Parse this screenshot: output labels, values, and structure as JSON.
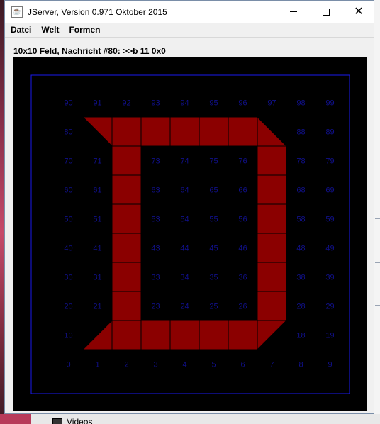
{
  "window": {
    "title": "JServer, Version 0.971 Oktober 2015",
    "icon": "java-icon",
    "controls": [
      "minimize",
      "maximize",
      "close"
    ],
    "close_glyph": "✕"
  },
  "menu": {
    "items": [
      "Datei",
      "Welt",
      "Formen"
    ]
  },
  "status": {
    "text": "10x10 Feld, Nachricht #80: >>b 11 0x0"
  },
  "board": {
    "rows": 10,
    "cols": 10,
    "background_color": "#000000",
    "border_color": "#1a1aee",
    "label_color": "#10108a",
    "piece_color": "#8b0000",
    "labels": [
      [
        "90",
        "91",
        "92",
        "93",
        "94",
        "95",
        "96",
        "97",
        "98",
        "99"
      ],
      [
        "80",
        "",
        "",
        "",
        "",
        "",
        "",
        "",
        "88",
        "89"
      ],
      [
        "70",
        "71",
        "",
        "73",
        "74",
        "75",
        "76",
        "",
        "78",
        "79"
      ],
      [
        "60",
        "61",
        "",
        "63",
        "64",
        "65",
        "66",
        "",
        "68",
        "69"
      ],
      [
        "50",
        "51",
        "",
        "53",
        "54",
        "55",
        "56",
        "",
        "58",
        "59"
      ],
      [
        "40",
        "41",
        "",
        "43",
        "44",
        "45",
        "46",
        "",
        "48",
        "49"
      ],
      [
        "30",
        "31",
        "",
        "33",
        "34",
        "35",
        "36",
        "",
        "38",
        "39"
      ],
      [
        "20",
        "21",
        "",
        "23",
        "24",
        "25",
        "26",
        "",
        "28",
        "29"
      ],
      [
        "10",
        "",
        "",
        "",
        "",
        "",
        "",
        "",
        "18",
        "19"
      ],
      [
        "0",
        "1",
        "2",
        "3",
        "4",
        "5",
        "6",
        "7",
        "8",
        "9"
      ]
    ],
    "filled_cells": [
      {
        "row": 1,
        "col": 1,
        "shape": "left-triangle"
      },
      {
        "row": 1,
        "col": 2,
        "shape": "square"
      },
      {
        "row": 1,
        "col": 3,
        "shape": "square"
      },
      {
        "row": 1,
        "col": 4,
        "shape": "square"
      },
      {
        "row": 1,
        "col": 5,
        "shape": "square"
      },
      {
        "row": 1,
        "col": 6,
        "shape": "square"
      },
      {
        "row": 1,
        "col": 7,
        "shape": "top-right-corner"
      },
      {
        "row": 2,
        "col": 2,
        "shape": "square"
      },
      {
        "row": 2,
        "col": 7,
        "shape": "square"
      },
      {
        "row": 3,
        "col": 2,
        "shape": "square"
      },
      {
        "row": 3,
        "col": 7,
        "shape": "square"
      },
      {
        "row": 4,
        "col": 2,
        "shape": "square"
      },
      {
        "row": 4,
        "col": 7,
        "shape": "square"
      },
      {
        "row": 5,
        "col": 2,
        "shape": "square"
      },
      {
        "row": 5,
        "col": 7,
        "shape": "square"
      },
      {
        "row": 6,
        "col": 2,
        "shape": "square"
      },
      {
        "row": 6,
        "col": 7,
        "shape": "square"
      },
      {
        "row": 7,
        "col": 2,
        "shape": "square"
      },
      {
        "row": 7,
        "col": 7,
        "shape": "square"
      },
      {
        "row": 8,
        "col": 1,
        "shape": "left-triangle-bottom"
      },
      {
        "row": 8,
        "col": 2,
        "shape": "square"
      },
      {
        "row": 8,
        "col": 3,
        "shape": "square"
      },
      {
        "row": 8,
        "col": 4,
        "shape": "square"
      },
      {
        "row": 8,
        "col": 5,
        "shape": "square"
      },
      {
        "row": 8,
        "col": 6,
        "shape": "square"
      },
      {
        "row": 8,
        "col": 7,
        "shape": "right-triangle-bottom"
      }
    ]
  },
  "background_app": {
    "visible_item": "Videos"
  }
}
